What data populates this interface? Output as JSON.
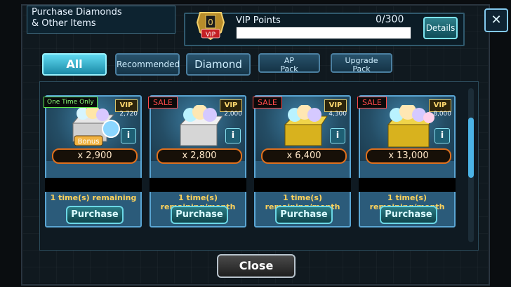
{
  "header": {
    "title_line1": "Purchase Diamonds",
    "title_line2": "& Other Items"
  },
  "vip": {
    "badge_letter": "0",
    "badge_text": "VIP",
    "label": "VIP Points",
    "points": "0/300",
    "details_label": "Details"
  },
  "tabs": [
    {
      "label": "All"
    },
    {
      "label": "Recommended"
    },
    {
      "label": "Diamond"
    },
    {
      "label_line1": "AP",
      "label_line2": "Pack"
    },
    {
      "label_line1": "Upgrade",
      "label_line2": "Pack"
    }
  ],
  "cards": [
    {
      "stamp": "One Time Only",
      "vip_text": "VIP",
      "vip_points": "2,720",
      "qty": "x 2,900",
      "remaining": "1 time(s) remaining",
      "purchase": "Purchase",
      "bonus_text": "Bonus"
    },
    {
      "stamp": "SALE",
      "vip_text": "VIP",
      "vip_points": "2,000",
      "qty": "x 2,800",
      "remaining": "1 time(s) remaining/month",
      "purchase": "Purchase"
    },
    {
      "stamp": "SALE",
      "vip_text": "VIP",
      "vip_points": "4,300",
      "qty": "x 6,400",
      "remaining": "1 time(s) remaining/month",
      "purchase": "Purchase"
    },
    {
      "stamp": "SALE",
      "vip_text": "VIP",
      "vip_points": "8,000",
      "qty": "x 13,000",
      "remaining": "1 time(s) remaining/month",
      "purchase": "Purchase"
    }
  ],
  "footer": {
    "close_label": "Close"
  },
  "colors": {
    "accent": "#6bd7e6",
    "sale": "#ff4a4a",
    "remaining": "#ffd35c",
    "qty_border": "#e0701d"
  }
}
